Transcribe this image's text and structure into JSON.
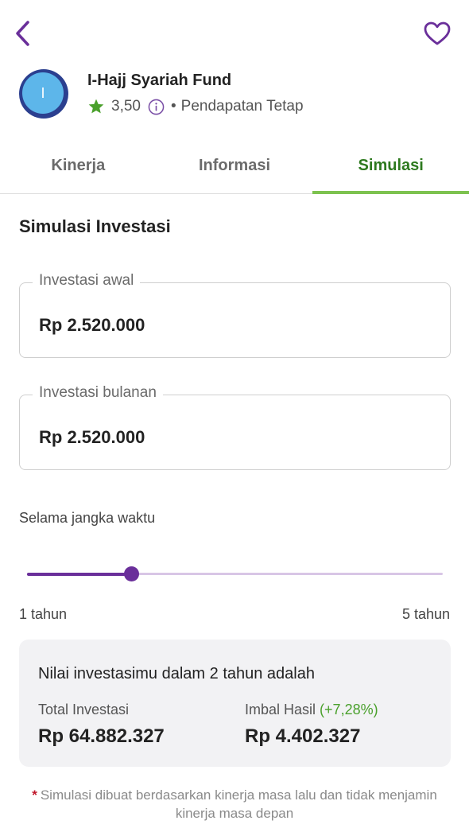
{
  "fund": {
    "avatar_letter": "I",
    "name": "I-Hajj Syariah Fund",
    "rating": "3,50",
    "category": "Pendapatan Tetap"
  },
  "tabs": [
    {
      "label": "Kinerja",
      "active": false
    },
    {
      "label": "Informasi",
      "active": false
    },
    {
      "label": "Simulasi",
      "active": true
    }
  ],
  "simulation": {
    "title": "Simulasi Investasi",
    "initial": {
      "label": "Investasi awal",
      "value": "Rp 2.520.000"
    },
    "monthly": {
      "label": "Investasi bulanan",
      "value": "Rp 2.520.000"
    },
    "duration": {
      "label": "Selama jangka waktu",
      "min_label": "1 tahun",
      "max_label": "5 tahun",
      "min": 1,
      "max": 5,
      "value": 2
    }
  },
  "result": {
    "heading": "Nilai investasimu dalam 2 tahun adalah",
    "total_label": "Total Investasi",
    "total_value": "Rp 64.882.327",
    "return_label": "Imbal Hasil",
    "return_pct": "(+7,28%)",
    "return_value": "Rp 4.402.327"
  },
  "disclaimer": {
    "asterisk": "*",
    "text": "Simulasi dibuat berdasarkan kinerja masa lalu dan tidak menjamin kinerja masa depan"
  },
  "colors": {
    "brand_purple": "#6a2f9a",
    "active_tab_green": "#2e7a1f",
    "tab_underline": "#7dc24f",
    "star": "#4aa02c",
    "positive": "#4aa02c",
    "asterisk": "#c0172a"
  },
  "icons": {
    "back": "chevron-left-icon",
    "favorite": "heart-outline-icon",
    "rating": "star-icon",
    "info": "info-circle-icon"
  }
}
